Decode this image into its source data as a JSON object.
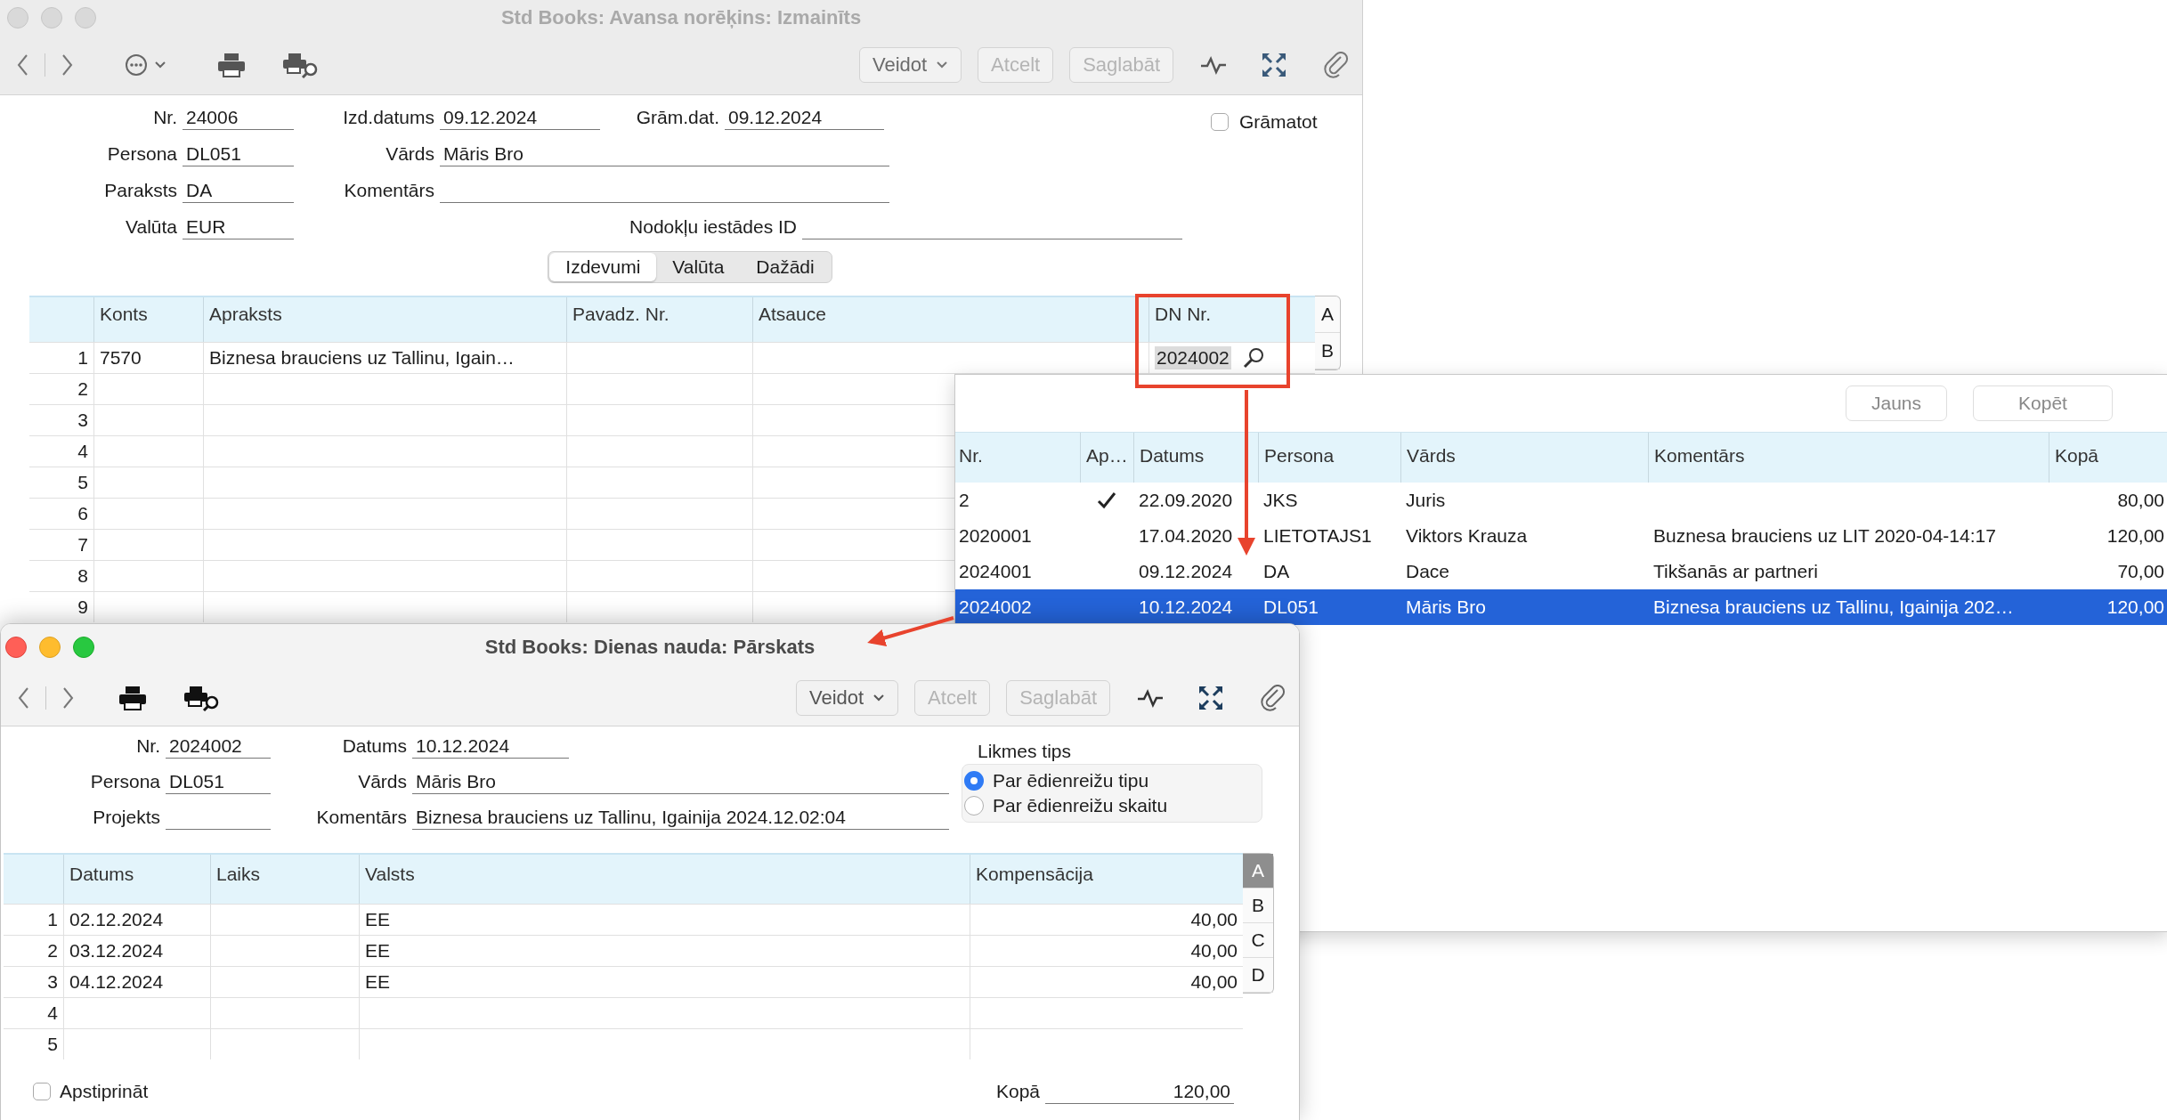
{
  "main_window": {
    "title": "Std Books: Avansa norēķins: Izmainīts",
    "active": false,
    "toolbar": {
      "show_more_menu": true,
      "buttons": [
        {
          "label": "Veidot",
          "kind": "menu",
          "disabled": false
        },
        {
          "label": "Atcelt",
          "kind": "plain",
          "disabled": true
        },
        {
          "label": "Saglabāt",
          "kind": "plain",
          "disabled": true
        }
      ]
    },
    "form_rows": [
      [
        {
          "label": "Nr.",
          "value": "24006"
        },
        {
          "label": "Izd.datums",
          "value": "09.12.2024"
        },
        {
          "label": "Grām.dat.",
          "value": "09.12.2024"
        }
      ],
      [
        {
          "label": "Persona",
          "value": "DL051"
        },
        {
          "label": "Vārds",
          "value": "Māris Bro"
        }
      ],
      [
        {
          "label": "Paraksts",
          "value": "DA"
        },
        {
          "label": "Komentārs"
        }
      ],
      [
        {
          "label": "Valūta",
          "value": "EUR"
        },
        {
          "label": "Nodokļu iestādes ID"
        }
      ]
    ],
    "posting_checkbox": {
      "label": "Grāmatot",
      "checked": false
    },
    "tabs": [
      {
        "label": "Izdevumi",
        "selected": true
      },
      {
        "label": "Valūta",
        "selected": false
      },
      {
        "label": "Dažādi",
        "selected": false
      }
    ],
    "table": {
      "columns": [
        "Konts",
        "Apraksts",
        "Pavadz. Nr.",
        "Atsauce",
        "DN Nr."
      ],
      "rows": [
        {
          "number": "1",
          "konts": "7570",
          "apraksts": "Biznesa brauciens uz Tallinu, Igain…",
          "dn_nr": "2024002"
        },
        {
          "number": "2"
        },
        {
          "number": "3"
        },
        {
          "number": "4"
        },
        {
          "number": "5"
        },
        {
          "number": "6"
        },
        {
          "number": "7"
        },
        {
          "number": "8"
        },
        {
          "number": "9"
        }
      ],
      "side_tabs": [
        {
          "label": "A",
          "selected": false
        },
        {
          "label": "B",
          "selected": false
        }
      ]
    }
  },
  "lookup_window": {
    "buttons": [
      "Jauns",
      "Kopēt"
    ],
    "columns": [
      "Nr.",
      "Ap…",
      "Datums",
      "Persona",
      "Vārds",
      "Komentārs",
      "Kopā"
    ],
    "rows": [
      {
        "nr": "2",
        "approved": true,
        "datums": "22.09.2020",
        "persona": "JKS",
        "vards": "Juris",
        "kopa": "80,00",
        "selected": false
      },
      {
        "nr": "2020001",
        "approved": false,
        "datums": "17.04.2020",
        "persona": "LIETOTAJS1",
        "vards": "Viktors Krauza",
        "komentars": "Buznesa brauciens uz LIT 2020-04-14:17",
        "kopa": "120,00",
        "selected": false
      },
      {
        "nr": "2024001",
        "approved": false,
        "datums": "09.12.2024",
        "persona": "DA",
        "vards": "Dace",
        "komentars": "Tikšanās ar partneri",
        "kopa": "70,00",
        "selected": false
      },
      {
        "nr": "2024002",
        "approved": false,
        "datums": "10.12.2024",
        "persona": "DL051",
        "vards": "Māris Bro",
        "komentars": "Biznesa brauciens uz Tallinu, Igainija 202…",
        "kopa": "120,00",
        "selected": true
      }
    ]
  },
  "detail_window": {
    "title": "Std Books: Dienas nauda: Pārskats",
    "active": true,
    "toolbar": {
      "buttons": [
        {
          "label": "Veidot",
          "kind": "menu",
          "disabled": false
        },
        {
          "label": "Atcelt",
          "kind": "plain",
          "disabled": true
        },
        {
          "label": "Saglabāt",
          "kind": "plain",
          "disabled": true
        }
      ]
    },
    "form_rows": [
      [
        {
          "label": "Nr.",
          "value": "2024002"
        },
        {
          "label": "Datums",
          "value": "10.12.2024"
        }
      ],
      [
        {
          "label": "Persona",
          "value": "DL051"
        },
        {
          "label": "Vārds",
          "value": "Māris Bro"
        }
      ],
      [
        {
          "label": "Projekts"
        },
        {
          "label": "Komentārs",
          "value": "Biznesa brauciens uz Tallinu, Igainija 2024.12.02:04"
        }
      ]
    ],
    "rate_type": {
      "label": "Likmes tips",
      "options": [
        {
          "label": "Par ēdienreižu tipu",
          "selected": true
        },
        {
          "label": "Par ēdienreižu skaitu",
          "selected": false
        }
      ]
    },
    "table": {
      "columns": [
        "Datums",
        "Laiks",
        "Valsts",
        "Kompensācija"
      ],
      "rows": [
        {
          "number": "1",
          "datums": "02.12.2024",
          "valsts": "EE",
          "kompensacija": "40,00"
        },
        {
          "number": "2",
          "datums": "03.12.2024",
          "valsts": "EE",
          "kompensacija": "40,00"
        },
        {
          "number": "3",
          "datums": "04.12.2024",
          "valsts": "EE",
          "kompensacija": "40,00"
        },
        {
          "number": "4"
        },
        {
          "number": "5"
        }
      ],
      "side_tabs": [
        {
          "label": "A",
          "selected": true
        },
        {
          "label": "B",
          "selected": false
        },
        {
          "label": "C",
          "selected": false
        },
        {
          "label": "D",
          "selected": false
        }
      ]
    },
    "confirm_checkbox": {
      "label": "Apstiprināt",
      "checked": false
    },
    "total": {
      "label": "Kopā",
      "value": "120,00"
    }
  }
}
